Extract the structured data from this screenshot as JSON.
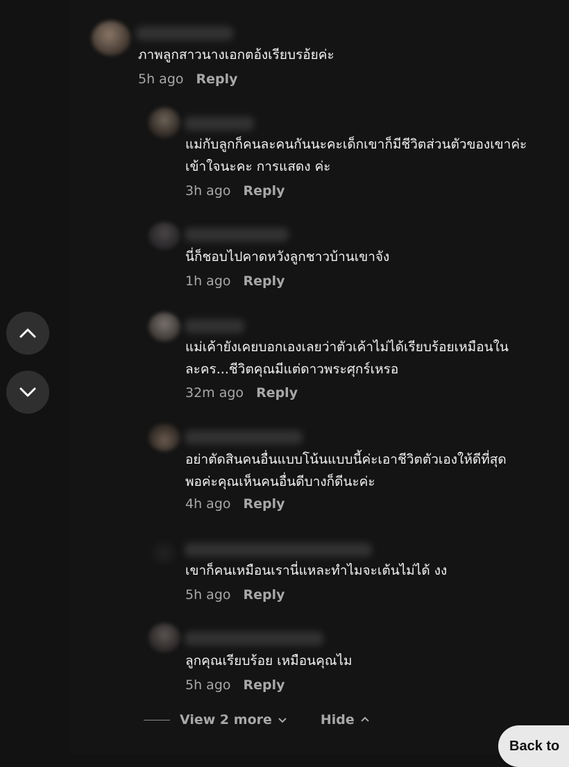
{
  "comments": [
    {
      "text": "ภาพลูกสาวนางเอกตอ้งเรียบรอ้ยค่ะ",
      "time": "5h ago",
      "reply": "Reply"
    },
    {
      "text": "แม่กับลูกก็คนละคนกันนะคะเด็กเขาก็มีชีวิตส่วนตัวของเขาค่ะ\nเข้าใจนะคะ การแสดง ค่ะ",
      "time": "3h ago",
      "reply": "Reply"
    },
    {
      "text": "นี่ก็ชอบไปคาดหวังลูกชาวบ้านเขาจัง",
      "time": "1h ago",
      "reply": "Reply"
    },
    {
      "text": "แม่เค้ายังเคยบอกเองเลยว่าตัวเค้าไม่ได้เรียบร้อยเหมือนใน\nละคร...ชีวิตคุณมีแต่ดาวพระศุกร์เหรอ",
      "time": "32m ago",
      "reply": "Reply"
    },
    {
      "text": "อย่าตัดสินคนอื่นแบบโน้นแบบนี้ค่ะเอาชีวิตตัวเองให้ดีที่สุด\nพอค่ะคุณเห็นคนอื่นดีบางก็ดีนะค่ะ",
      "time": "4h ago",
      "reply": "Reply"
    },
    {
      "text": "เขาก็คนเหมือนเรานี่แหละทำไมจะเต้นไม่ได้ งง",
      "time": "5h ago",
      "reply": "Reply"
    },
    {
      "text": "ลูกคุณเรียบร้อย เหมือนคุณไม",
      "time": "5h ago",
      "reply": "Reply"
    }
  ],
  "footer": {
    "view_more": "View 2 more",
    "hide": "Hide",
    "view_more_icon": "chevron-down-icon",
    "hide_icon": "chevron-up-icon"
  },
  "nav": {
    "up_icon": "chevron-up-icon",
    "down_icon": "chevron-down-icon"
  },
  "back_to_top": "Back to",
  "colors": {
    "background": "#121212",
    "text": "#ffffff",
    "muted": "#a8a8a8",
    "button": "#2f2f2f"
  }
}
